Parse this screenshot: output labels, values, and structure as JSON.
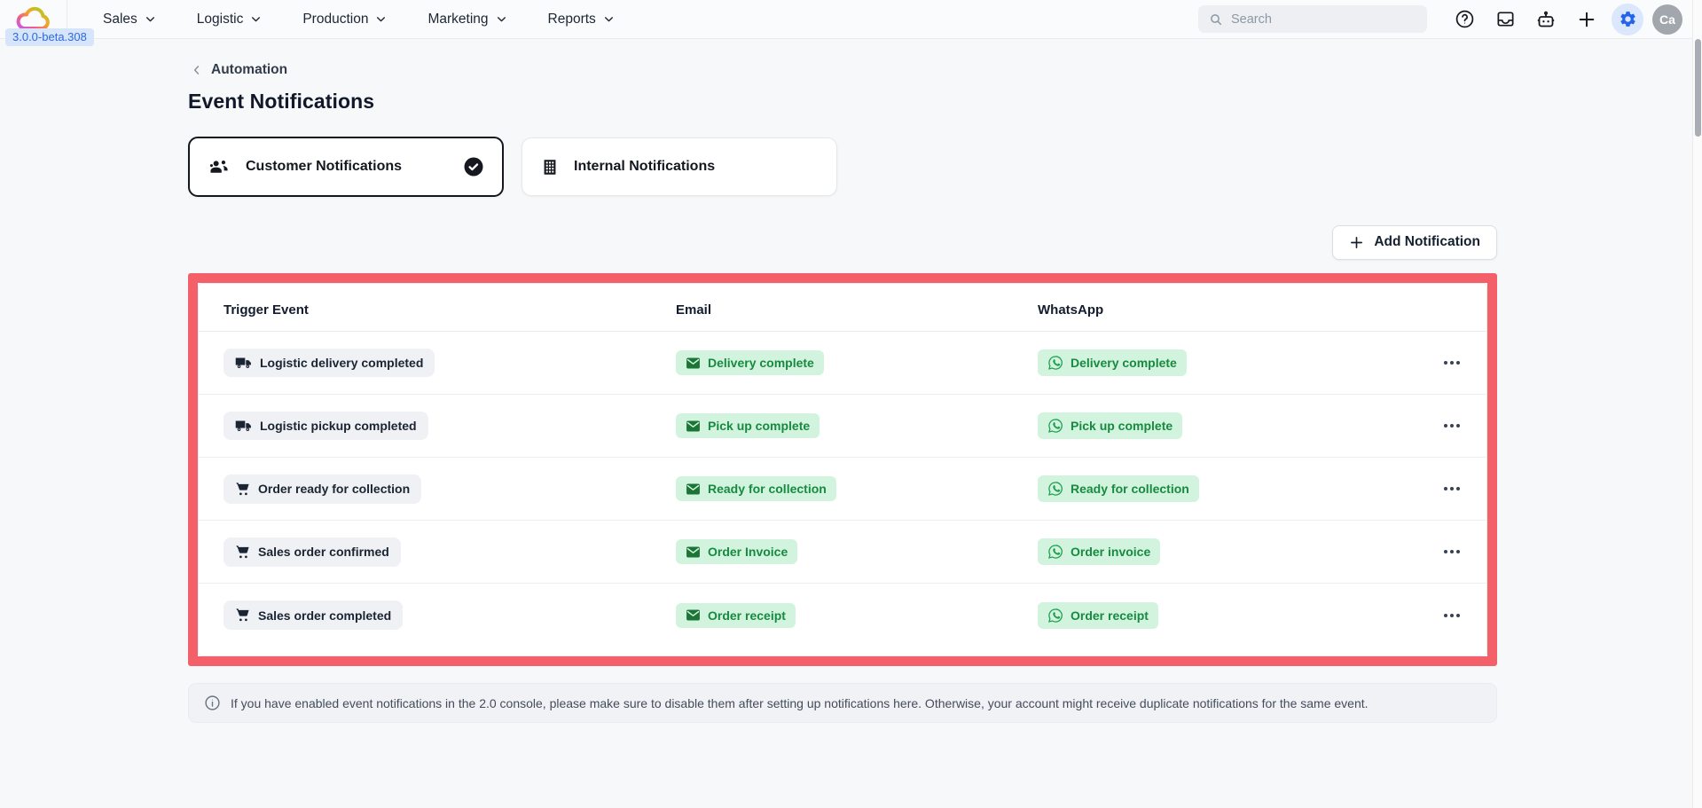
{
  "nav": {
    "version_badge": "3.0.0-beta.308",
    "menu": [
      {
        "label": "Sales"
      },
      {
        "label": "Logistic"
      },
      {
        "label": "Production"
      },
      {
        "label": "Marketing"
      },
      {
        "label": "Reports"
      }
    ],
    "search_placeholder": "Search",
    "help_glyph": "?",
    "avatar_initials": "Ca"
  },
  "page": {
    "breadcrumb": "Automation",
    "title": "Event Notifications",
    "tabs": [
      {
        "label": "Customer Notifications",
        "icon": "people-icon",
        "selected": true
      },
      {
        "label": "Internal Notifications",
        "icon": "building-icon",
        "selected": false
      }
    ],
    "add_button_label": "Add Notification"
  },
  "table": {
    "columns": [
      "Trigger Event",
      "Email",
      "WhatsApp"
    ],
    "rows": [
      {
        "trigger": "Logistic delivery completed",
        "trigger_icon": "truck-icon",
        "email": "Delivery complete",
        "whatsapp": "Delivery complete"
      },
      {
        "trigger": "Logistic pickup completed",
        "trigger_icon": "truck-icon",
        "email": "Pick up complete",
        "whatsapp": "Pick up complete"
      },
      {
        "trigger": "Order ready for collection",
        "trigger_icon": "cart-icon",
        "email": "Ready for collection",
        "whatsapp": "Ready for collection"
      },
      {
        "trigger": "Sales order confirmed",
        "trigger_icon": "cart-icon",
        "email": "Order Invoice",
        "whatsapp": "Order invoice"
      },
      {
        "trigger": "Sales order completed",
        "trigger_icon": "cart-icon",
        "email": "Order receipt",
        "whatsapp": "Order receipt"
      }
    ]
  },
  "info_banner": {
    "text": "If you have enabled event notifications in the 2.0 console, please make sure to disable them after setting up notifications here. Otherwise, your account might receive duplicate notifications for the same event."
  },
  "colors": {
    "highlight_border": "#f4606a",
    "pill_green_bg": "#d2f4de",
    "pill_green_text": "#178a40",
    "pill_gray_bg": "#eff1f4",
    "accent_blue": "#2563eb",
    "badge_bg": "#d7e5fa",
    "badge_text": "#2d6ae3"
  }
}
